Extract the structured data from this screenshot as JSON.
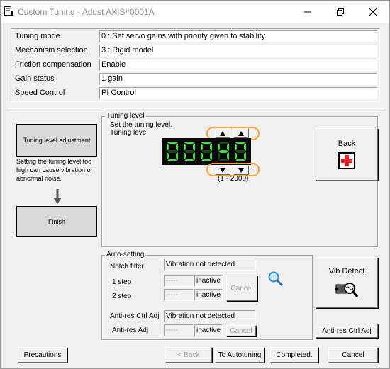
{
  "window": {
    "title": "Custom Tuning - Adust AXIS#0001A"
  },
  "info": [
    {
      "label": "Tuning mode",
      "value": "0 : Set servo gains with priority given to stability."
    },
    {
      "label": "Mechanism selection",
      "value": "3 : Rigid model"
    },
    {
      "label": "Friction compensation",
      "value": "Enable"
    },
    {
      "label": "Gain status",
      "value": "1 gain"
    },
    {
      "label": "Speed Control",
      "value": "PI Control"
    }
  ],
  "steps": {
    "adjust": "Tuning level adjustment",
    "note": "Setting the tuning level too high can cause vibration or abnormal noise.",
    "finish": "Finish"
  },
  "tuning": {
    "title": "Tuning level",
    "instruction": "Set the tuning level.",
    "label": "Tuning level",
    "value": "00040",
    "range": "(1 - 2000)",
    "up_icon": "triangle-up",
    "down_icon": "triangle-down"
  },
  "back": {
    "label": "Back",
    "icon": "red-cross"
  },
  "auto": {
    "title": "Auto-setting",
    "notch_label": "Notch filter",
    "notch_status": "Vibration not detected",
    "step1": "1 step",
    "step2": "2 step",
    "step1_value": "-----",
    "step2_value": "-----",
    "step1_state": "inactive",
    "step2_state": "inactive",
    "cancel": "Cancel",
    "antires_label": "Anti-res Ctrl Adj",
    "antires_status": "Vibration not detected",
    "antires_adj_label": "Anti-res Adj",
    "antires_value": "-----",
    "antires_state": "inactive",
    "antires_cancel": "Cancel"
  },
  "vib": {
    "label": "Vib Detect",
    "icon": "magnifier-icon"
  },
  "antires_button": "Anti-res Ctrl Adj",
  "footer": {
    "precautions": "Precautions",
    "back": "< Back",
    "autotuning": "To Autotuning",
    "completed": "Completed.",
    "cancel": "Cancel"
  },
  "colors": {
    "lcd_on": "#4cd84c",
    "lcd_off": "#1f4a1f",
    "highlight": "#f5a43c",
    "cross": "#e0202a"
  }
}
